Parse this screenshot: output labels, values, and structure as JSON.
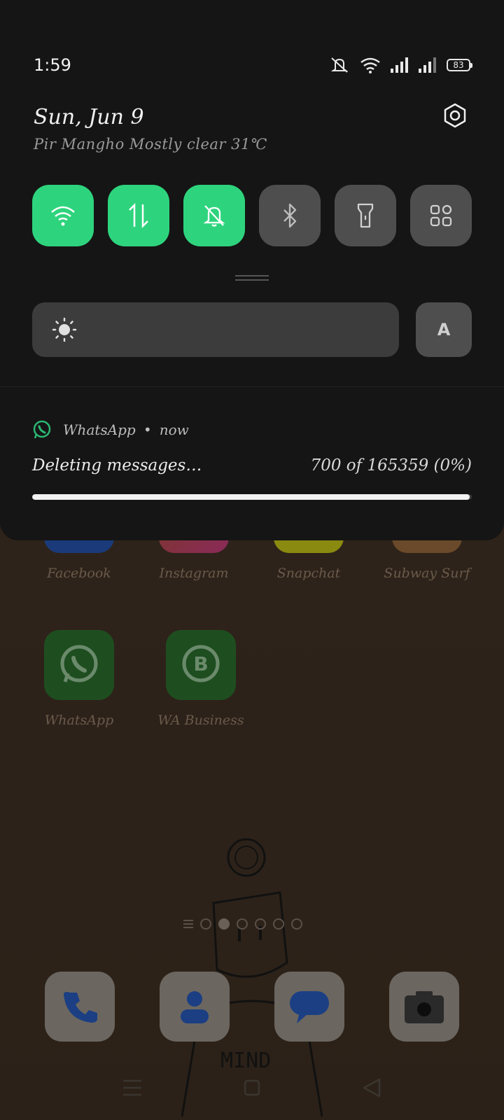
{
  "status_bar": {
    "time": "1:59",
    "battery": "83",
    "icons": [
      "mute-icon",
      "wifi-icon",
      "signal-icon",
      "signal-icon-2",
      "battery-icon"
    ]
  },
  "header": {
    "date": "Sun, Jun 9",
    "weather": "Pir Mangho Mostly clear 31℃"
  },
  "toggles": [
    {
      "name": "wifi",
      "on": true
    },
    {
      "name": "mobile-data",
      "on": true
    },
    {
      "name": "silent",
      "on": true
    },
    {
      "name": "bluetooth",
      "on": false
    },
    {
      "name": "flashlight",
      "on": false
    },
    {
      "name": "more-tiles",
      "on": false
    }
  ],
  "brightness": {
    "auto_label": "A"
  },
  "notification": {
    "app": "WhatsApp",
    "separator": "•",
    "when": "now",
    "title": "Deleting messages…",
    "count": "700 of 165359 (0%)",
    "progress_fraction": 0.995
  },
  "home": {
    "apps_row1": [
      "Facebook",
      "Instagram",
      "Snapchat",
      "Subway Surf"
    ],
    "apps_row2": [
      "WhatsApp",
      "WA Business"
    ],
    "page_count": 6,
    "current_page": 1
  },
  "colors": {
    "accent": "#2ed47d",
    "shade": "#151515"
  }
}
